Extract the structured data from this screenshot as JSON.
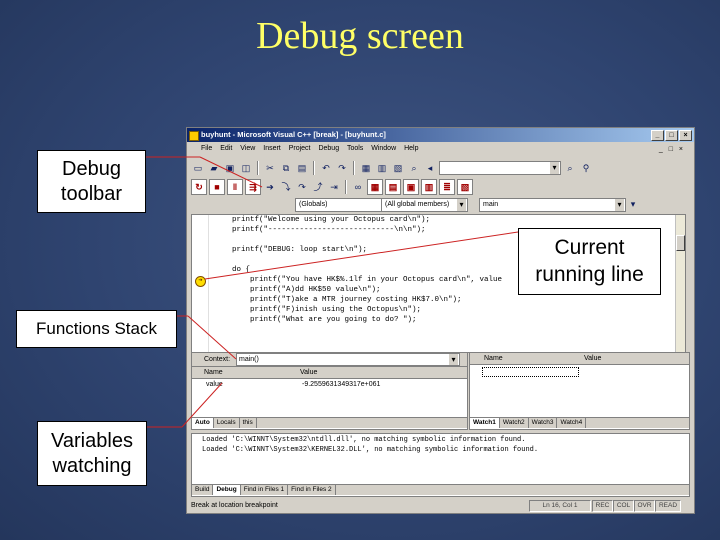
{
  "slide": {
    "title": "Debug screen"
  },
  "callouts": {
    "debug_toolbar": "Debug toolbar",
    "current_line": "Current running line",
    "functions_stack": "Functions Stack",
    "variables": "Variables watching"
  },
  "window": {
    "title": "buyhunt - Microsoft Visual C++ [break] - [buyhunt.c]",
    "menu": [
      "File",
      "Edit",
      "View",
      "Insert",
      "Project",
      "Debug",
      "Tools",
      "Window",
      "Help"
    ]
  },
  "wizard_bar": {
    "scope": "(Globals)",
    "members": "(All global members)",
    "function": "main"
  },
  "editor": {
    "lines": [
      "    printf(\"Welcome using your Octopus card\\n\");",
      "    printf(\"----------------------------\\n\\n\");",
      "",
      "    printf(\"DEBUG: loop start\\n\");",
      "",
      "    do {",
      "        printf(\"You have HK$%.1lf in your Octopus card\\n\", value",
      "        printf(\"A)dd HK$50 value\\n\");",
      "        printf(\"T)ake a MTR journey costing HK$7.0\\n\");",
      "        printf(\"F)inish using the Octopus\\n\");",
      "        printf(\"What are you going to do? \");",
      ""
    ],
    "current_line_index": 6
  },
  "variables_pane": {
    "context_label": "Context:",
    "context_value": "main()",
    "columns": [
      "Name",
      "Value"
    ],
    "rows": [
      {
        "name": "value",
        "value": "-9.2559631349317e+061"
      }
    ],
    "tabs": [
      "Auto",
      "Locals",
      "this"
    ],
    "active_tab": "Auto"
  },
  "watch_pane": {
    "columns": [
      "Name",
      "Value"
    ],
    "tabs": [
      "Watch1",
      "Watch2",
      "Watch3",
      "Watch4"
    ],
    "active_tab": "Watch1"
  },
  "output_pane": {
    "lines": [
      "Loaded 'C:\\WINNT\\System32\\ntdll.dll', no matching symbolic information found.",
      "Loaded 'C:\\WINNT\\System32\\KERNEL32.DLL', no matching symbolic information found."
    ],
    "tabs": [
      "Build",
      "Debug",
      "Find in Files 1",
      "Find in Files 2"
    ],
    "active_tab": "Debug"
  },
  "status": {
    "message": "Break at location breakpoint",
    "position": "Ln 16, Col 1",
    "indicators": [
      "REC",
      "COL",
      "OVR",
      "READ"
    ]
  },
  "colors": {
    "title": "#ffff66",
    "callout_line": "#cc2222",
    "background": "#2f4470"
  }
}
